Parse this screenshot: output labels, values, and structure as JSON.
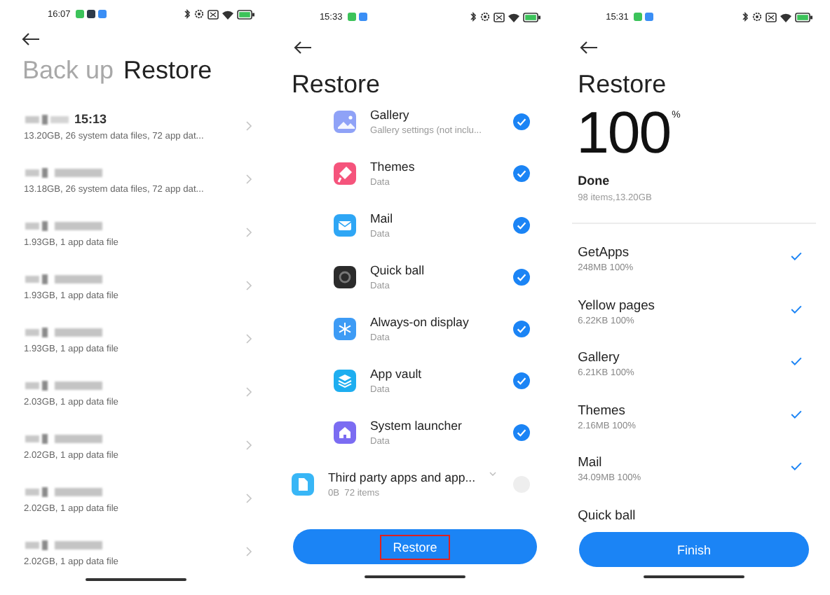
{
  "screens": [
    {
      "kind": "backup_list",
      "status_bar": {
        "time": "16:07",
        "notifications": [
          {
            "color": "#3cc35a"
          },
          {
            "color": "#2d3a4a"
          },
          {
            "color": "#3a8ef5"
          }
        ]
      },
      "tabs": [
        {
          "label": "Back up",
          "selected": false
        },
        {
          "label": "Restore",
          "selected": true
        }
      ],
      "backups": [
        {
          "title": "15:13",
          "details": "13.20GB, 26 system data files, 72 app dat..."
        },
        {
          "details": "13.18GB, 26 system data files, 72 app dat..."
        },
        {
          "details": "1.93GB, 1 app data file"
        },
        {
          "details": "1.93GB, 1 app data file"
        },
        {
          "details": "1.93GB, 1 app data file"
        },
        {
          "details": "2.03GB, 1 app data file"
        },
        {
          "details": "2.02GB, 1 app data file"
        },
        {
          "details": "2.02GB, 1 app data file"
        },
        {
          "details": "2.02GB, 1 app data file"
        }
      ]
    },
    {
      "kind": "restore_select",
      "status_bar": {
        "time": "15:33",
        "notifications": [
          {
            "color": "#3cc35a"
          },
          {
            "color": "#3a8ef5"
          }
        ]
      },
      "title": "Restore",
      "items": [
        {
          "kind": "app",
          "name": "Gallery",
          "details": "Gallery settings (not inclu...",
          "color": "#8fa2f7",
          "checked": true
        },
        {
          "kind": "app",
          "name": "Themes",
          "details": "Data",
          "color": "#f5547c",
          "checked": true
        },
        {
          "kind": "app",
          "name": "Mail",
          "details": "Data",
          "color": "#2ea6f5",
          "checked": true
        },
        {
          "kind": "app",
          "name": "Quick ball",
          "details": "Data",
          "color": "#2b2b2b",
          "checked": true
        },
        {
          "kind": "app",
          "name": "Always-on display",
          "details": "Data",
          "color": "#3d9bf5",
          "checked": true
        },
        {
          "kind": "app",
          "name": "App vault",
          "details": "Data",
          "color": "#1eaef0",
          "checked": true
        },
        {
          "kind": "app",
          "name": "System launcher",
          "details": "Data",
          "color": "#7b6cf2",
          "checked": true
        },
        {
          "kind": "group",
          "name": "Third party apps and app...",
          "details": "0B  72 items",
          "color": "#38b6f6",
          "checked": false
        }
      ],
      "button": {
        "label": "Restore",
        "highlighted": true
      }
    },
    {
      "kind": "restore_done",
      "status_bar": {
        "time": "15:31",
        "notifications": [
          {
            "color": "#3cc35a"
          },
          {
            "color": "#3a8ef5"
          }
        ]
      },
      "title": "Restore",
      "percent": "100",
      "percent_sign": "%",
      "status": "Done",
      "summary": "98 items,13.20GB",
      "items": [
        {
          "name": "GetApps",
          "details": "248MB 100%",
          "done": true
        },
        {
          "name": "Yellow pages",
          "details": "6.22KB 100%",
          "done": true
        },
        {
          "name": "Gallery",
          "details": "6.21KB 100%",
          "done": true
        },
        {
          "name": "Themes",
          "details": "2.16MB 100%",
          "done": true
        },
        {
          "name": "Mail",
          "details": "34.09MB 100%",
          "done": true
        },
        {
          "name": "Quick ball"
        }
      ],
      "button": {
        "label": "Finish"
      }
    }
  ]
}
